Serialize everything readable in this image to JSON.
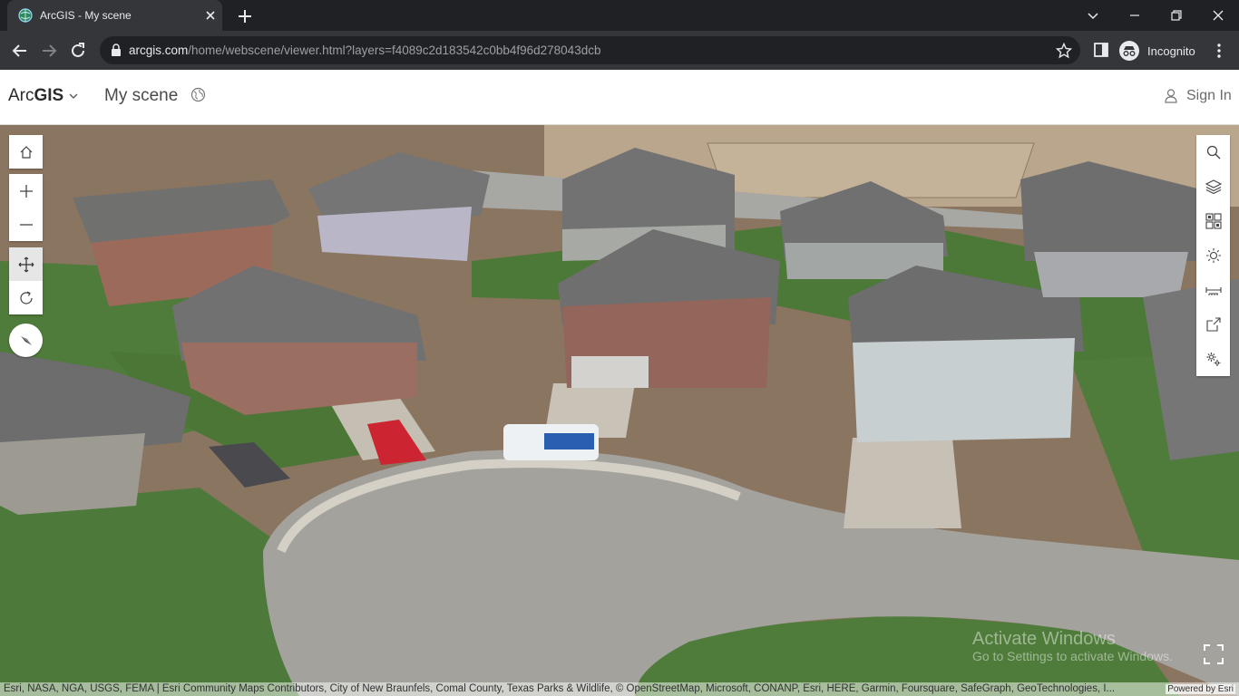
{
  "browser": {
    "tab_title": "ArcGIS - My scene",
    "url_host": "arcgis.com",
    "url_path": "/home/webscene/viewer.html?layers=f4089c2d183542c0bb4f96d278043dcb",
    "profile_label": "Incognito"
  },
  "app": {
    "brand_light": "Arc",
    "brand_bold": "GIS",
    "scene_title": "My scene",
    "sign_in": "Sign In"
  },
  "map": {
    "watermark_line1": "Activate Windows",
    "watermark_line2": "Go to Settings to activate Windows.",
    "attribution": "Esri, NASA, NGA, USGS, FEMA | Esri Community Maps Contributors, City of New Braunfels, Comal County, Texas Parks & Wildlife, © OpenStreetMap, Microsoft, CONANP, Esri, HERE, Garmin, Foursquare, SafeGraph, GeoTechnologies, I...",
    "powered_by": "Powered by Esri",
    "left_tools": [
      "home-icon",
      "zoom-in-icon",
      "zoom-out-icon",
      "pan-icon",
      "rotate-icon",
      "compass-icon"
    ],
    "right_tools": [
      "search-icon",
      "layers-icon",
      "basemap-icon",
      "daylight-icon",
      "measure-icon",
      "share-icon",
      "settings-icon"
    ]
  },
  "colors": {
    "chrome_dark": "#202124",
    "chrome_toolbar": "#35363a",
    "accent_text": "#e8eaed"
  }
}
